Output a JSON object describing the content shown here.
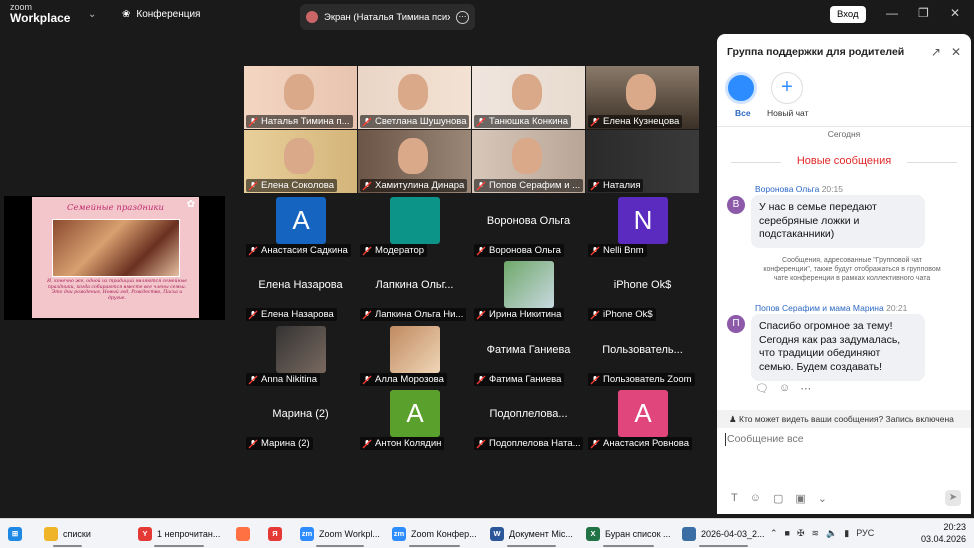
{
  "titlebar": {
    "logo_line1": "zoom",
    "logo_line2": "Workplace",
    "conference_label": "Конференция",
    "screen_tab": "Экран (Наталья Тимина психолог",
    "signin_label": "Вход"
  },
  "shared_slide": {
    "title": "Семейные праздники",
    "text": "И, конечно же, одной из традиций являются семейные праздники, когда собираются вместе все члены семьи. Это дни рождения, Новый год, Рождество, Пасха и другие."
  },
  "participants": [
    {
      "name": "Наталья Тимина п...",
      "kind": "video"
    },
    {
      "name": "Светлана Шушунова",
      "kind": "video"
    },
    {
      "name": "Танюшка Конкина",
      "kind": "video"
    },
    {
      "name": "Елена Кузнецова",
      "kind": "video"
    },
    {
      "name": "Елена Соколова",
      "kind": "video"
    },
    {
      "name": "Хамитулина Динара",
      "kind": "video"
    },
    {
      "name": "Попов Серафим и ...",
      "kind": "video"
    },
    {
      "name": "Наталия",
      "kind": "video"
    },
    {
      "name": "Анастасия Садкина",
      "kind": "avatar",
      "letter": "A",
      "color": "#1565c0"
    },
    {
      "name": "Модератор",
      "kind": "avatar",
      "letter": "",
      "color": "#0d9488"
    },
    {
      "name": "Воронова Ольга",
      "kind": "text",
      "big": "Воронова Ольга"
    },
    {
      "name": "Nelli Bnm",
      "kind": "avatar",
      "letter": "N",
      "color": "#5b2bbf"
    },
    {
      "name": "Елена Назарова",
      "kind": "text",
      "big": "Елена Назарова"
    },
    {
      "name": "Лапкина Ольга Ни...",
      "kind": "text",
      "big": "Лапкина Ольг..."
    },
    {
      "name": "Ирина Никитина",
      "kind": "photo"
    },
    {
      "name": "iPhone Ok$",
      "kind": "text",
      "big": "iPhone Ok$"
    },
    {
      "name": "Anna Nikitina",
      "kind": "photo"
    },
    {
      "name": "Алла Морозова",
      "kind": "photo"
    },
    {
      "name": "Фатима Ганиева",
      "kind": "text",
      "big": "Фатима Ганиева"
    },
    {
      "name": "Пользователь Zoom",
      "kind": "text",
      "big": "Пользователь..."
    },
    {
      "name": "Марина (2)",
      "kind": "text",
      "big": "Марина (2)"
    },
    {
      "name": "Антон Колядин",
      "kind": "avatar",
      "letter": "A",
      "color": "#5aa02c"
    },
    {
      "name": "Подоплелова Ната...",
      "kind": "text",
      "big": "Подоплелова..."
    },
    {
      "name": "Анастасия Ровнова",
      "kind": "avatar",
      "letter": "A",
      "color": "#e0457b"
    }
  ],
  "chat": {
    "title": "Группа поддержки для родителей ...",
    "tab_all": "Все",
    "tab_new": "Новый чат",
    "today": "Сегодня",
    "new_messages": "Новые сообщения",
    "messages": [
      {
        "sender": "Воронова Ольга",
        "time": "20:15",
        "initial": "В",
        "text": "У нас в семье передают серебряные ложки и подстаканники)"
      },
      {
        "sender": "Попов Серафим и мама Марина",
        "time": "20:21",
        "initial": "П",
        "text": "Спасибо огромное за тему! Сегодня как раз задумалась, что традиции обединяют семью. Будем создавать!"
      }
    ],
    "system_note": "Сообщения, адресованные \"Групповой чат конференции\", также будут отображаться в групповом чате конференции в рамках коллективного чата",
    "visibility": "Кто может видеть ваши сообщения? Запись включена",
    "placeholder": "Сообщение все"
  },
  "taskbar": {
    "items": [
      {
        "label": "списки",
        "color": "#f0b429",
        "glyph": ""
      },
      {
        "label": "1 непрочитан...",
        "color": "#e53935",
        "glyph": "Y"
      },
      {
        "label": "",
        "color": "#ff7043",
        "glyph": ""
      },
      {
        "label": "",
        "color": "#e53935",
        "glyph": "Я"
      },
      {
        "label": "Zoom Workpl...",
        "color": "#2d8cff",
        "glyph": "zm"
      },
      {
        "label": "Zoom Конфер...",
        "color": "#2d8cff",
        "glyph": "zm"
      },
      {
        "label": "Документ Mic...",
        "color": "#2b579a",
        "glyph": "W"
      },
      {
        "label": "Буран список ...",
        "color": "#217346",
        "glyph": "X"
      },
      {
        "label": "2026-04-03_2...",
        "color": "#3a6ea5",
        "glyph": ""
      }
    ],
    "lang": "РУС",
    "time": "20:23",
    "date": "03.04.2026"
  }
}
